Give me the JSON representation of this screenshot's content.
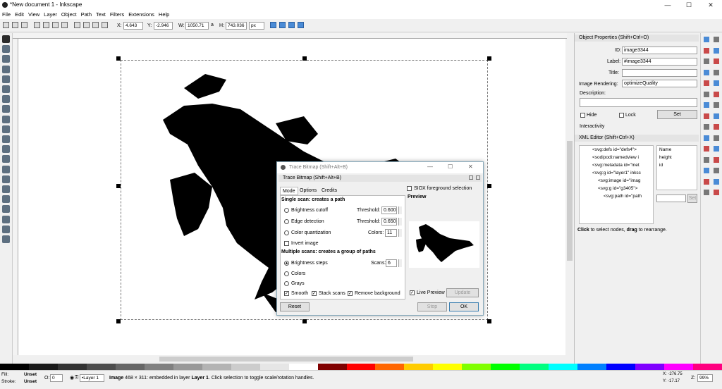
{
  "window": {
    "title": "*New document 1 - Inkscape",
    "minimize": "—",
    "maximize": "☐",
    "close": "✕"
  },
  "menu": [
    "File",
    "Edit",
    "View",
    "Layer",
    "Object",
    "Path",
    "Text",
    "Filters",
    "Extensions",
    "Help"
  ],
  "controls": {
    "x_label": "X:",
    "x": "4.643",
    "y_label": "Y:",
    "y": "-2.946",
    "w_label": "W:",
    "w": "1050.71",
    "h_label": "H:",
    "h": "743.036",
    "unit": "px"
  },
  "tools": [
    "selector-tool",
    "node-tool",
    "tweak-tool",
    "zoom-tool",
    "measure-tool",
    "rect-tool",
    "3dbox-tool",
    "circle-tool",
    "star-tool",
    "spiral-tool",
    "pencil-tool",
    "pen-tool",
    "calligraphy-tool",
    "text-tool",
    "spray-tool",
    "eraser-tool",
    "bucket-tool",
    "gradient-tool",
    "mesh-tool",
    "dropper-tool",
    "connector-tool"
  ],
  "object_properties": {
    "title": "Object Properties (Shift+Ctrl+O)",
    "id_label": "ID:",
    "id": "image3344",
    "label_label": "Label:",
    "label": "#image3344",
    "title_label": "Title:",
    "title_value": "",
    "rendering_label": "Image Rendering:",
    "rendering": "optimizeQuality",
    "description_label": "Description:",
    "hide": "Hide",
    "lock": "Lock",
    "set": "Set",
    "interactivity": "Interactivity"
  },
  "xml_editor": {
    "title": "XML Editor (Shift+Ctrl+X)",
    "nodes": [
      "<svg:defs id=\"defs4\">",
      "<sodipodi:namedview i",
      "<svg:metadata id=\"met",
      "<svg:g id=\"layer1\" inksc",
      "<svg:image id=\"imag",
      "<svg:g id=\"g3405\">",
      "<svg:path id=\"path"
    ],
    "attrs": [
      "Name",
      "height",
      "id"
    ],
    "set": "Set",
    "hint_pre": "Click",
    "hint_mid": " to select nodes, ",
    "hint_bold": "drag",
    "hint_post": " to rearrange."
  },
  "trace": {
    "window_title": "Trace Bitmap (Shift+Alt+B)",
    "panel_title": "Trace Bitmap (Shift+Alt+B)",
    "tabs": [
      "Mode",
      "Options",
      "Credits"
    ],
    "single_heading": "Single scan: creates a path",
    "brightness_cutoff": "Brightness cutoff",
    "threshold_label": "Threshold:",
    "threshold1": "0.600",
    "edge_detection": "Edge detection",
    "threshold2": "0.650",
    "color_quant": "Color quantization",
    "colors_label": "Colors:",
    "colors": "11",
    "invert": "Invert image",
    "multi_heading": "Multiple scans: creates a group of paths",
    "brightness_steps": "Brightness steps",
    "scans_label": "Scans:",
    "scans": "6",
    "colors_opt": "Colors",
    "grays_opt": "Grays",
    "smooth": "Smooth",
    "stack": "Stack scans",
    "remove_bg": "Remove background",
    "siox": "SIOX foreground selection",
    "preview": "Preview",
    "live_preview": "Live Preview",
    "update": "Update",
    "reset": "Reset",
    "stop": "Stop",
    "ok": "OK"
  },
  "status": {
    "fill_label": "Fill:",
    "fill": "Unset",
    "stroke_label": "Stroke:",
    "stroke": "Unset",
    "opacity_label": "O:",
    "opacity": "0",
    "layer": "•Layer 1",
    "msg_bold": "Image",
    "msg": " 468 × 311: embedded in layer ",
    "msg_layer": "Layer 1",
    "msg_tail": ". Click selection to toggle scale/rotation handles.",
    "coords_x": "X: -276.75",
    "coords_y": "Y: -17.17",
    "zoom_label": "Z:",
    "zoom": "99%"
  },
  "palette": [
    "#000000",
    "#1a1a1a",
    "#333333",
    "#4d4d4d",
    "#666666",
    "#808080",
    "#999999",
    "#b3b3b3",
    "#cccccc",
    "#e6e6e6",
    "#ffffff",
    "#800000",
    "#ff0000",
    "#ff6600",
    "#ffcc00",
    "#ffff00",
    "#80ff00",
    "#00ff00",
    "#00ff80",
    "#00ffff",
    "#0080ff",
    "#0000ff",
    "#8000ff",
    "#ff00ff",
    "#ff0080"
  ]
}
